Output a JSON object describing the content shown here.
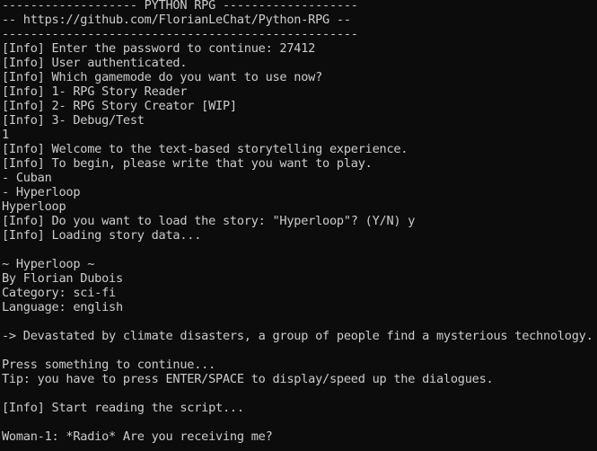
{
  "terminal": {
    "text_color": "#cccccc",
    "background_color": "#0c0c0c",
    "lines": [
      "------------------- PYTHON RPG -------------------",
      "-- https://github.com/FlorianLeChat/Python-RPG --",
      "--------------------------------------------------",
      "[Info] Enter the password to continue: 27412",
      "[Info] User authenticated.",
      "[Info] Which gamemode do you want to use now?",
      "[Info] 1- RPG Story Reader",
      "[Info] 2- RPG Story Creator [WIP]",
      "[Info] 3- Debug/Test",
      "1",
      "[Info] Welcome to the text-based storytelling experience.",
      "[Info] To begin, please write that you want to play.",
      "- Cuban",
      "- Hyperloop",
      "Hyperloop",
      "[Info] Do you want to load the story: \"Hyperloop\"? (Y/N) y",
      "[Info] Loading story data...",
      "",
      "~ Hyperloop ~",
      "By Florian Dubois",
      "Category: sci-fi",
      "Language: english",
      "",
      "-> Devastated by climate disasters, a group of people find a mysterious technology.",
      "",
      "Press something to continue...",
      "Tip: you have to press ENTER/SPACE to display/speed up the dialogues.",
      "",
      "[Info] Start reading the script...",
      "",
      "Woman-1: *Radio* Are you receiving me?"
    ]
  }
}
